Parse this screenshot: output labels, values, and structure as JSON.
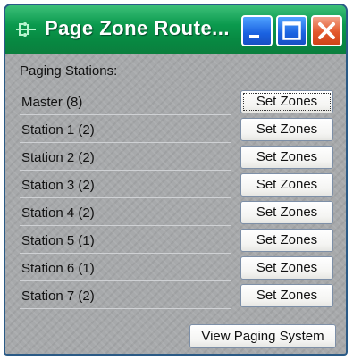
{
  "window": {
    "title": "Page Zone Route..."
  },
  "title_buttons": {
    "minimize": "minimize-icon",
    "maximize": "maximize-icon",
    "close": "close-icon"
  },
  "paging": {
    "section_label": "Paging Stations:",
    "set_zones_label": "Set Zones",
    "stations": [
      {
        "name": "Master (8)"
      },
      {
        "name": "Station 1 (2)"
      },
      {
        "name": "Station 2 (2)"
      },
      {
        "name": "Station 3 (2)"
      },
      {
        "name": "Station 4 (2)"
      },
      {
        "name": "Station 5 (1)"
      },
      {
        "name": "Station 6 (1)"
      },
      {
        "name": "Station 7 (2)"
      }
    ],
    "view_button_label": "View Paging System"
  },
  "colors": {
    "titlebar": "#0b9a4e",
    "window_buttons": "#1a61e0",
    "close_button": "#e3582c"
  }
}
